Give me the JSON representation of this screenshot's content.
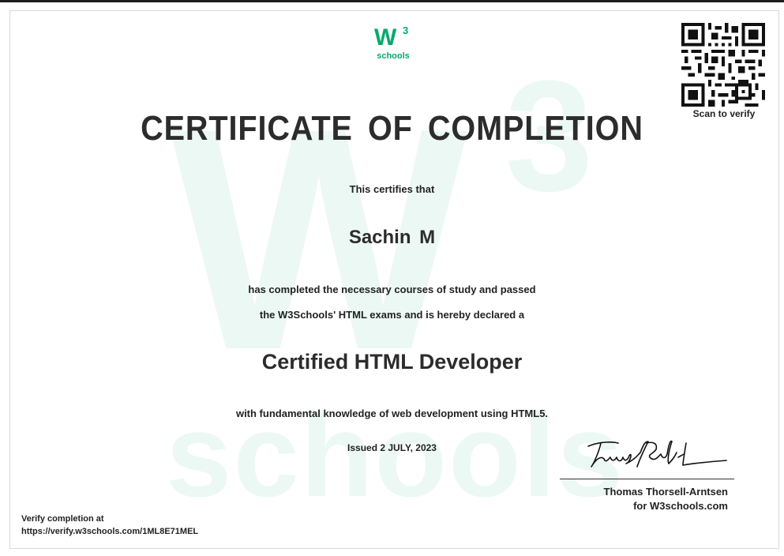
{
  "logo": {
    "mark": "W",
    "superscript": "3",
    "text": "schools",
    "color": "#04aa6d"
  },
  "qr": {
    "icon": "qr-code-icon",
    "label": "Scan to verify"
  },
  "certificate": {
    "title": "CERTIFICATE OF COMPLETION",
    "intro": "This certifies that",
    "name": "Sachin M",
    "body_line_1": "has completed the necessary courses of study and passed",
    "body_line_2": "the W3Schools' HTML exams and is hereby declared a",
    "designation": "Certified HTML Developer",
    "knowledge": "with fundamental knowledge of web development using HTML5.",
    "issued": "Issued 2 JULY, 2023"
  },
  "signer": {
    "signature_icon": "handwritten-signature-icon",
    "name": "Thomas Thorsell-Arntsen",
    "org": "for W3schools.com"
  },
  "verification": {
    "label": "Verify completion at",
    "url": "https://verify.w3schools.com/1ML8E71MEL"
  },
  "watermark": {
    "w": "W",
    "three": "3",
    "schools": "schools"
  }
}
